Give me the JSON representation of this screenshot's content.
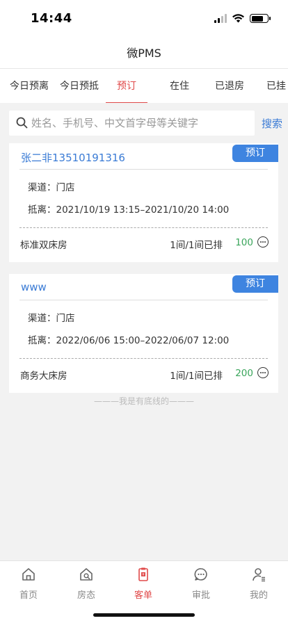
{
  "status": {
    "time": "14:44"
  },
  "header": {
    "title": "微PMS"
  },
  "tabs": [
    {
      "label": "今日预离"
    },
    {
      "label": "今日预抵"
    },
    {
      "label": "预订"
    },
    {
      "label": "在住"
    },
    {
      "label": "已退房"
    },
    {
      "label": "已挂"
    }
  ],
  "active_tab": "预订",
  "search": {
    "placeholder": "姓名、手机号、中文首字母等关键字",
    "button": "搜索"
  },
  "orders": [
    {
      "name": "张二非13510191316",
      "badge": "预订",
      "channel": "渠道：门店",
      "period": "抵离：2021/10/19 13:15–2021/10/20 14:00",
      "room_type": "标准双床房",
      "room_count": "1间/1间已排",
      "price": "100"
    },
    {
      "name": "www",
      "badge": "预订",
      "channel": "渠道：门店",
      "period": "抵离：2022/06/06 15:00–2022/06/07 12:00",
      "room_type": "商务大床房",
      "room_count": "1间/1间已排",
      "price": "200"
    }
  ],
  "list_end": "———我是有底线的———",
  "bottom_nav": [
    {
      "label": "首页",
      "icon": "home-icon"
    },
    {
      "label": "房态",
      "icon": "room-status-icon"
    },
    {
      "label": "客单",
      "icon": "order-icon"
    },
    {
      "label": "审批",
      "icon": "approval-icon"
    },
    {
      "label": "我的",
      "icon": "profile-icon"
    }
  ],
  "colors": {
    "accent_red": "#e04a4a",
    "link_blue": "#3a7bd5",
    "badge_blue": "#3e84e0",
    "price_green": "#3aa55b"
  }
}
